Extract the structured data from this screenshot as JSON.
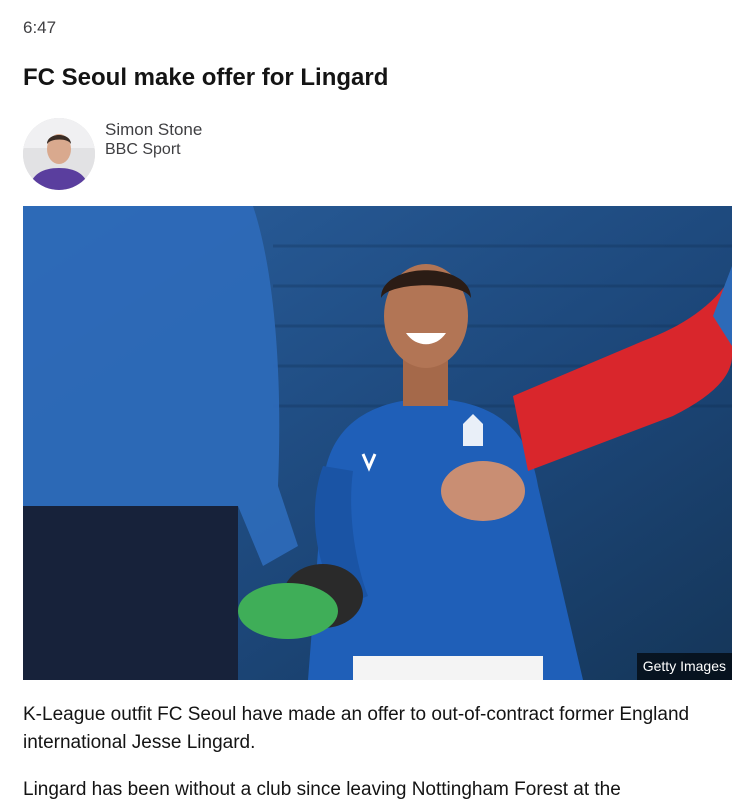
{
  "post": {
    "time": "6:47",
    "headline": "FC Seoul make offer for Lingard",
    "author": {
      "name": "Simon Stone",
      "role": "BBC Sport"
    },
    "image": {
      "credit": "Getty Images"
    },
    "paragraphs": [
      "K-League outfit FC Seoul have made an offer to out-of-contract former England international Jesse Lingard.",
      "Lingard has been without a club since leaving Nottingham Forest at the"
    ]
  },
  "colors": {
    "text": "#141414",
    "secondary_text": "#3f3f42",
    "kit_blue": "#1f5fb8",
    "sleeve_red": "#d9262c"
  }
}
